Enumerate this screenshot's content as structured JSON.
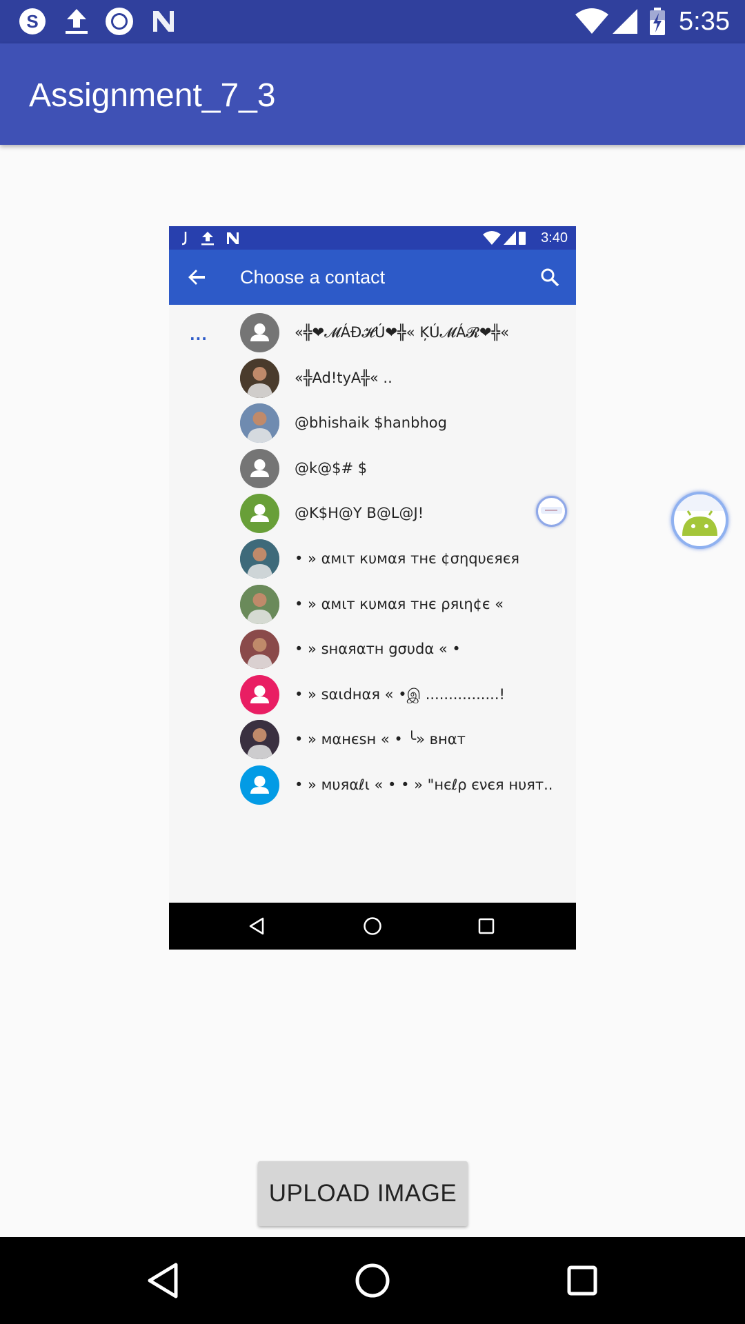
{
  "status_bar": {
    "time": "5:35",
    "left_icons": [
      "skype-icon",
      "upload-icon",
      "circle-app-icon",
      "n-logo-icon"
    ],
    "right_icons": [
      "wifi-icon",
      "signal-icon",
      "battery-charging-icon"
    ],
    "background": "#30409d"
  },
  "app_bar": {
    "title": "Assignment_7_3",
    "background": "#3f51b5"
  },
  "screenshot": {
    "status_time": "3:40",
    "toolbar_title": "Choose a contact",
    "toolbar_background": "#2d5ac8",
    "overflow_dots": "...",
    "contacts": [
      {
        "name": "«╬❤𝓜ÁĐ𝓗Ú❤╬« ĶÚ𝓜Á𝓡❤╬«",
        "avatar": "placeholder",
        "color": "#757575"
      },
      {
        "name": "«╬Ad!tyA╬« ..",
        "avatar": "photo",
        "color": "#4a3b2c"
      },
      {
        "name": "@bhishaik $hanbhog",
        "avatar": "photo",
        "color": "#6f8bb0"
      },
      {
        "name": "@k@$# $",
        "avatar": "placeholder",
        "color": "#757575"
      },
      {
        "name": "@K$H@Y B@L@J!",
        "avatar": "placeholder",
        "color": "#689f38"
      },
      {
        "name": "• » αмιт кυмαя тнє ¢σηqυєяєя",
        "avatar": "photo",
        "color": "#3e6a7a"
      },
      {
        "name": "• » αмιт кυмαя тнє ρяιη¢є «",
        "avatar": "photo",
        "color": "#6a8a5a"
      },
      {
        "name": "• » ѕнαяαтн gσυdα « •",
        "avatar": "photo",
        "color": "#8a4a4a"
      },
      {
        "name": "• » ѕαιdнαя « •இ ................!",
        "avatar": "placeholder",
        "color": "#e91e63"
      },
      {
        "name": "• » мαнєѕн « • ╰» внαт",
        "avatar": "photo",
        "color": "#3a3040"
      },
      {
        "name": "• » мυяαℓι « • • » \"нєℓρ єνєя нυят..",
        "avatar": "placeholder",
        "color": "#039be5"
      }
    ]
  },
  "upload_button": {
    "label": "UPLOAD IMAGE"
  },
  "nav_bar": {
    "buttons": [
      "back-icon",
      "home-icon",
      "recents-icon"
    ]
  }
}
